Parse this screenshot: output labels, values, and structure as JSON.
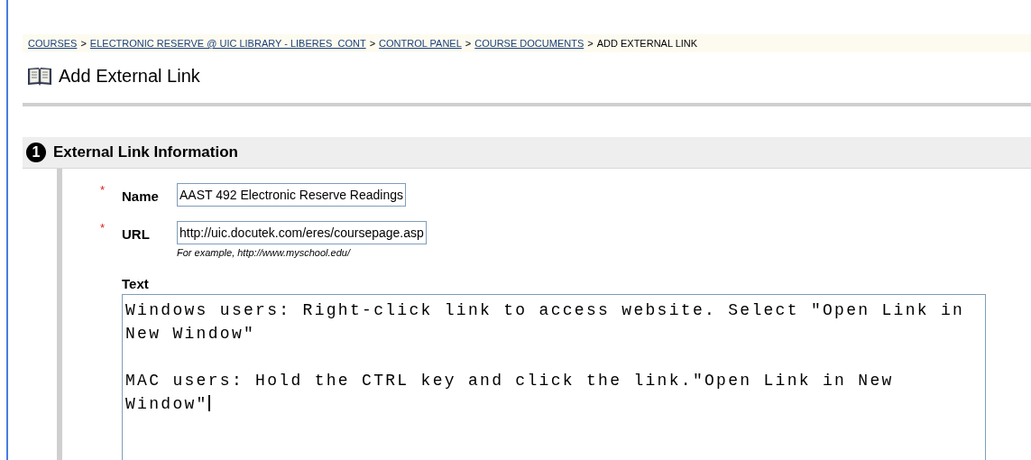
{
  "breadcrumb": {
    "links": [
      "COURSES",
      "ELECTRONIC RESERVE @ UIC LIBRARY - LIBERES_CONT",
      "CONTROL PANEL",
      "COURSE DOCUMENTS"
    ],
    "separator": ">",
    "current": "ADD EXTERNAL LINK"
  },
  "page_title": "Add External Link",
  "section": {
    "step": "1",
    "title": "External Link Information"
  },
  "fields": [
    {
      "label": "Name",
      "required": true,
      "value": "AAST 492 Electronic Reserve Readings"
    },
    {
      "label": "URL",
      "required": true,
      "value": "http://uic.docutek.com/eres/coursepage.asp",
      "hint": "For example, http://www.myschool.edu/"
    }
  ],
  "required_mark": "*",
  "text_field": {
    "label": "Text",
    "paragraphs": [
      "Windows users: Right-click link to access website. Select \"Open Link in New Window\"",
      "MAC users: Hold the CTRL key and click the link.\"Open Link in New Window\""
    ]
  }
}
